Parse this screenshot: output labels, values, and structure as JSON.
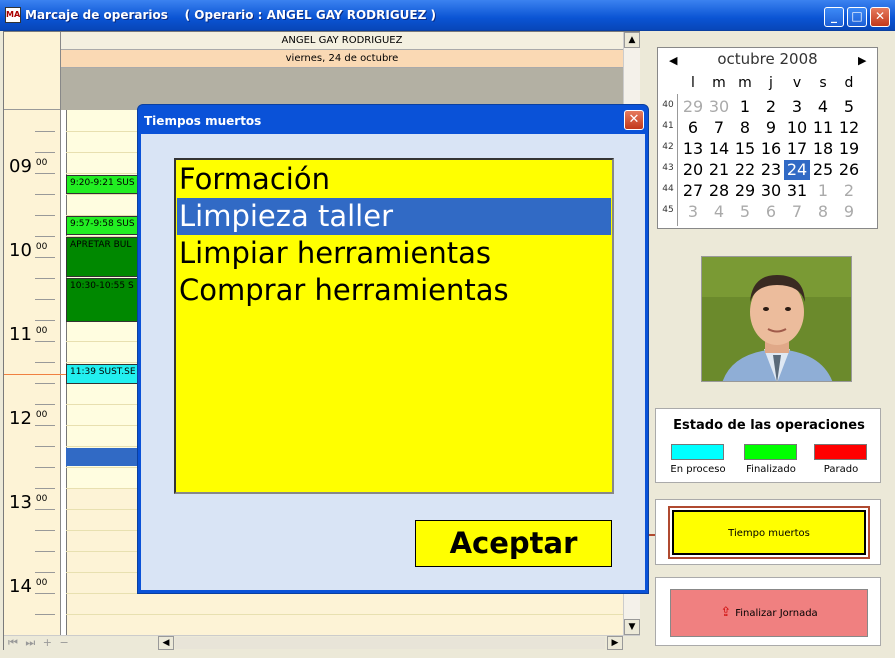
{
  "window": {
    "title": "Marcaje de operarios    ( Operario : ANGEL GAY RODRIGUEZ )",
    "icon_text": "MA"
  },
  "schedule": {
    "operator_name": "ANGEL GAY RODRIGUEZ",
    "date": "viernes, 24 de octubre",
    "hours": [
      {
        "h": "09",
        "m": "00"
      },
      {
        "h": "10",
        "m": "00"
      },
      {
        "h": "11",
        "m": "00"
      },
      {
        "h": "12",
        "m": "00"
      },
      {
        "h": "13",
        "m": "00"
      },
      {
        "h": "14",
        "m": "00"
      }
    ],
    "appointments": [
      {
        "label": "9:20-9:21 SUS",
        "status": "finalizado"
      },
      {
        "label": "9:57-9:58 SUS",
        "status": "finalizado"
      },
      {
        "label": "APRETAR BUL",
        "status": "finalizado"
      },
      {
        "label": "10:30-10:55 S",
        "status": "finalizado"
      },
      {
        "label": "11:39 SUST.SE",
        "status": "en proceso"
      }
    ],
    "nav_buttons": "⏮ ⏭ + −"
  },
  "modal": {
    "title": "Tiempos muertos",
    "close_label": "✕",
    "reasons": [
      "Formación",
      "Limpieza taller",
      "Limpiar herramientas",
      "Comprar herramientas"
    ],
    "selected_index": 1,
    "accept_label": "Aceptar"
  },
  "calendar": {
    "month_label": "octubre 2008",
    "weekdays": [
      "l",
      "m",
      "m",
      "j",
      "v",
      "s",
      "d"
    ],
    "weeks": [
      {
        "num": "40",
        "days": [
          "29",
          "30",
          "1",
          "2",
          "3",
          "4",
          "5"
        ]
      },
      {
        "num": "41",
        "days": [
          "6",
          "7",
          "8",
          "9",
          "10",
          "11",
          "12"
        ]
      },
      {
        "num": "42",
        "days": [
          "13",
          "14",
          "15",
          "16",
          "17",
          "18",
          "19"
        ]
      },
      {
        "num": "43",
        "days": [
          "20",
          "21",
          "22",
          "23",
          "24",
          "25",
          "26"
        ]
      },
      {
        "num": "44",
        "days": [
          "27",
          "28",
          "29",
          "30",
          "31",
          "1",
          "2"
        ]
      },
      {
        "num": "45",
        "days": [
          "3",
          "4",
          "5",
          "6",
          "7",
          "8",
          "9"
        ]
      }
    ],
    "selected_day": "24"
  },
  "status": {
    "title": "Estado de las operaciones",
    "items": [
      {
        "label": "En proceso",
        "color": "#00ffff"
      },
      {
        "label": "Finalizado",
        "color": "#00ff00"
      },
      {
        "label": "Parado",
        "color": "#ff0000"
      }
    ]
  },
  "actions": {
    "dead_time_label": "Tiempo muertos",
    "finish_label": "Finalizar Jornada"
  },
  "colors": {
    "titlebar": "#0a54d4",
    "selection": "#316ac5",
    "list_bg": "#ffff00"
  }
}
